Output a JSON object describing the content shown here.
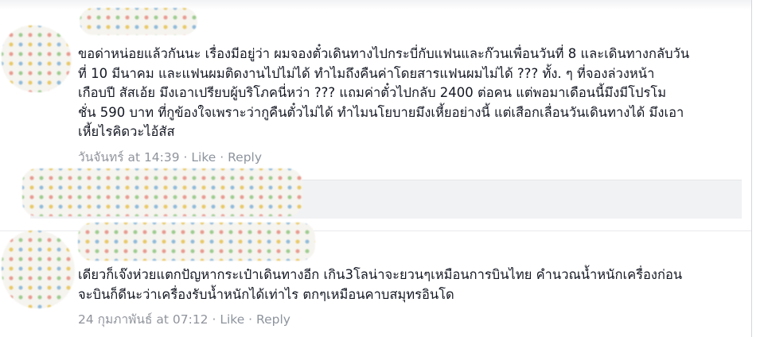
{
  "comments": [
    {
      "text": "ขอด่าหน่อยแล้วกันนะ เรื่องมีอยู่ว่า ผมจองตั๋วเดินทางไปกระบี่กับแฟนและก๊วนเพื่อนวันที่ 8 และเดินทางกลับวัน\nที่ 10 มีนาคม และแฟนผมติดงานไปไม่ได้ ทำไมถึงคืนค่าโดยสารแฟนผมไม่ได้ ??? ทั้ง. ๆ ที่จองล่วงหน้า\nเกือบปี สัสเอ้ย มึงเอาเปรียบผู้บริโภคนี่หว่า ??? แถมค่าตั๋วไปกลับ 2400 ต่อคน แต่พอมาเดือนนี้มึงมีโปรโม\nชั่น 590 บาท ที่กูข้องใจเพราะว่ากูคืนตั๋วไม่ได้ ทำไมนโยบายมึงเหี้ยอย่างนี้ แต่เสือกเลื่อนวันเดินทางได้ มึงเอา\nเหี้ยไรคิดวะไอ้สัส",
      "timestamp": "วันจันทร์ at 14:39",
      "like": "Like",
      "reply": "Reply"
    },
    {
      "text": "เดียวก็เจ๊งห่วยแตกปัญหากระเป๋าเดินทางอีก เกิน3โลน่าจะยวนๆเหมือนการบินไทย คำนวณน้ำหนักเครื่องก่อน\nจะบินก็ดีนะว่าเครื่องรับน้ำหนักได้เท่าไร ตกๆเหมือนคาบสมุทรอินโด",
      "timestamp": "24 กุมภาพันธ์ at 07:12",
      "like": "Like",
      "reply": "Reply"
    }
  ],
  "separator": " · ",
  "icons": {
    "avatar": "blurred-avatar-icon",
    "name": "blurred-name-icon"
  }
}
